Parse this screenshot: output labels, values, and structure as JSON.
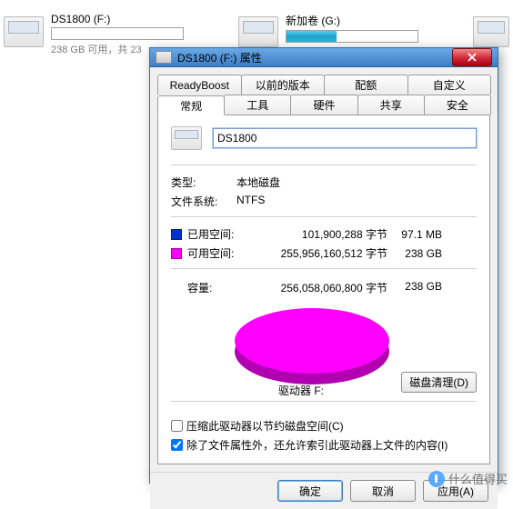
{
  "drives": [
    {
      "name": "DS1800 (F:)",
      "fill_pct": 0,
      "sub": "238 GB 可用，共 23"
    },
    {
      "name": "新加卷 (G:)",
      "fill_pct": 38,
      "sub": ""
    }
  ],
  "dialog": {
    "title": "DS1800 (F:) 属性",
    "tabs_row1": [
      "ReadyBoost",
      "以前的版本",
      "配额",
      "自定义"
    ],
    "tabs_row2": [
      "常规",
      "工具",
      "硬件",
      "共享",
      "安全"
    ],
    "active_tab": "常规",
    "drive_name_value": "DS1800",
    "type_label": "类型:",
    "type_value": "本地磁盘",
    "fs_label": "文件系统:",
    "fs_value": "NTFS",
    "used_label": "已用空间:",
    "used_bytes": "101,900,288 字节",
    "used_hr": "97.1 MB",
    "free_label": "可用空间:",
    "free_bytes": "255,956,160,512 字节",
    "free_hr": "238 GB",
    "cap_label": "容量:",
    "cap_bytes": "256,058,060,800 字节",
    "cap_hr": "238 GB",
    "drive_letter_label": "驱动器 F:",
    "cleanup_btn": "磁盘清理(D)",
    "chk1_label": "压缩此驱动器以节约磁盘空间(C)",
    "chk1_checked": false,
    "chk2_label": "除了文件属性外，还允许索引此驱动器上文件的内容(I)",
    "chk2_checked": true,
    "ok": "确定",
    "cancel": "取消",
    "apply": "应用(A)"
  },
  "watermark": "什么值得买",
  "chart_data": {
    "type": "pie",
    "title": "驱动器 F:",
    "series": [
      {
        "name": "已用空间",
        "value": 101900288,
        "display": "97.1 MB",
        "color": "#0033cc"
      },
      {
        "name": "可用空间",
        "value": 255956160512,
        "display": "238 GB",
        "color": "#ff00ff"
      }
    ],
    "total": {
      "value": 256058060800,
      "display": "238 GB"
    }
  }
}
